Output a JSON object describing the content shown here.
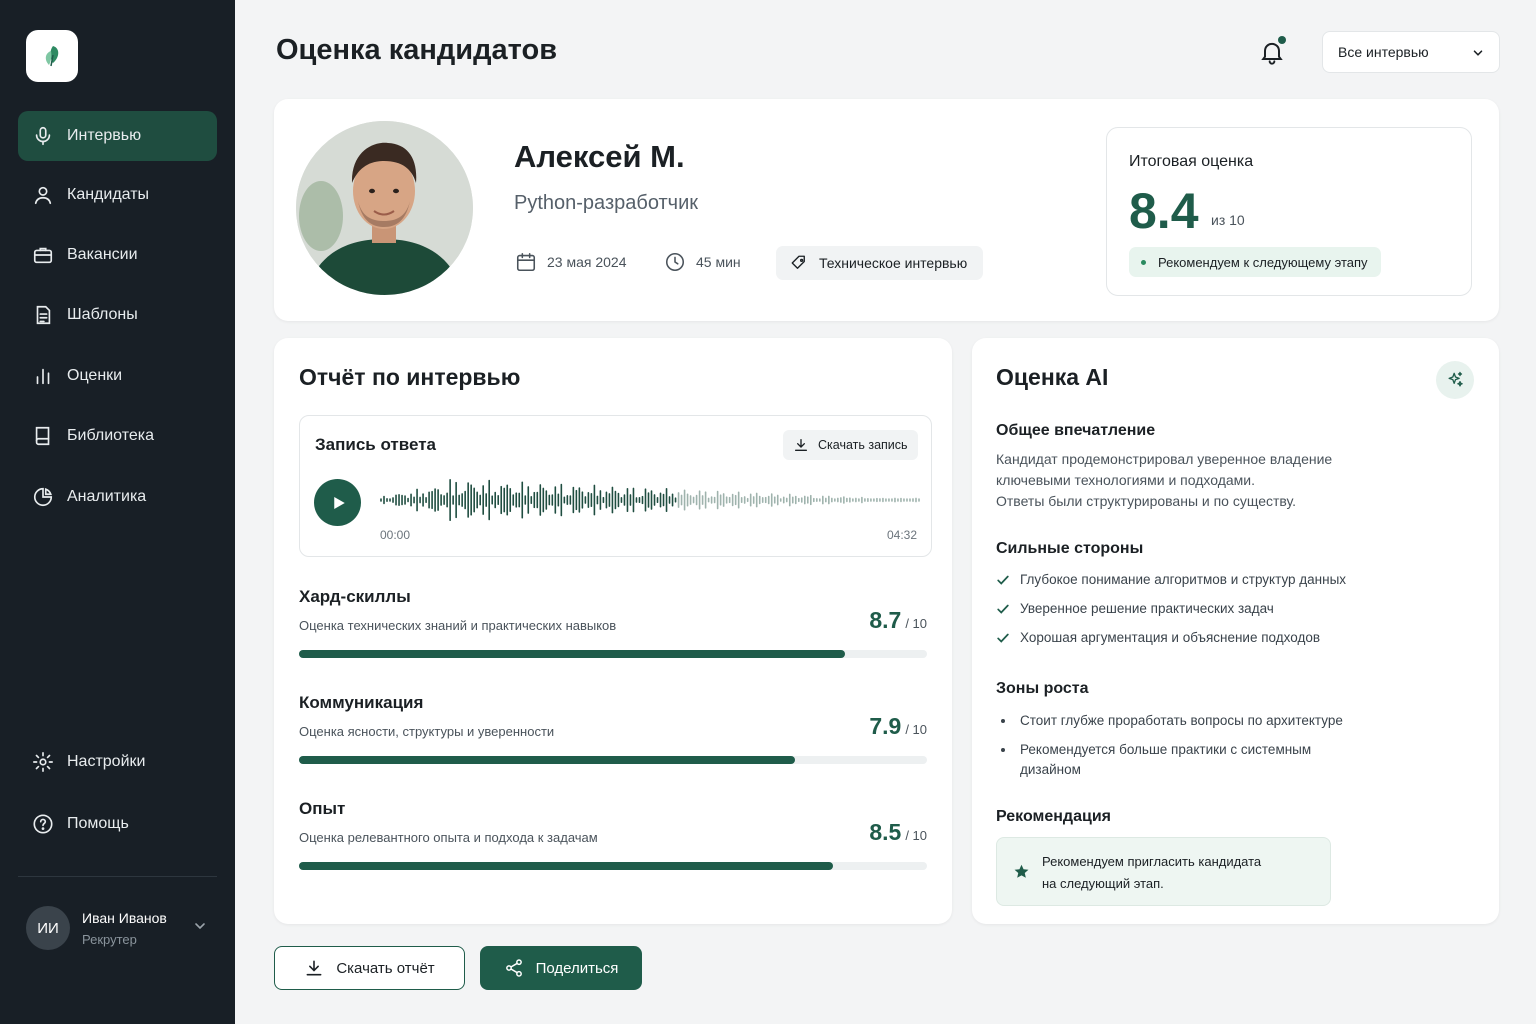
{
  "colors": {
    "accent": "#1f5c4a",
    "sidebar_bg": "#181f26",
    "active_nav": "#1f4d40",
    "badge_bg": "#e8f4ee"
  },
  "sidebar": {
    "logo_icon": "leaf-icon",
    "items": [
      {
        "label": "Интервью",
        "icon": "microphone-icon",
        "active": true
      },
      {
        "label": "Кандидаты",
        "icon": "user-icon"
      },
      {
        "label": "Вакансии",
        "icon": "briefcase-icon"
      },
      {
        "label": "Шаблоны",
        "icon": "document-icon"
      },
      {
        "label": "Оценки",
        "icon": "bar-chart-icon"
      },
      {
        "label": "Библиотека",
        "icon": "book-icon"
      },
      {
        "label": "Аналитика",
        "icon": "pie-chart-icon"
      }
    ],
    "bottom_items": [
      {
        "label": "Настройки",
        "icon": "gear-icon"
      },
      {
        "label": "Помощь",
        "icon": "help-icon"
      }
    ],
    "user": {
      "initials": "ИИ",
      "name": "Иван Иванов",
      "role": "Рекрутер"
    }
  },
  "header": {
    "title": "Оценка кандидатов",
    "filter": "Все интервью"
  },
  "candidate": {
    "name": "Алексей М.",
    "role": "Python-разработчик",
    "date": "23 мая 2024",
    "duration": "45 мин",
    "interview_type": "Техническое интервью",
    "score_label": "Итоговая оценка",
    "score": "8.4",
    "score_of": "из 10",
    "recommendation": "Рекомендуем к следующему этапу"
  },
  "report": {
    "title": "Отчёт по интервью",
    "audio": {
      "title": "Запись ответа",
      "download_label": "Скачать запись",
      "start_time": "00:00",
      "end_time": "04:32",
      "progress": 0.0
    },
    "skills": [
      {
        "name": "Хард-скиллы",
        "desc": "Оценка технических знаний и практических навыков",
        "score": "8.7",
        "of": "/ 10",
        "value": 8.7
      },
      {
        "name": "Коммуникация",
        "desc": "Оценка ясности, структуры и уверенности",
        "score": "7.9",
        "of": "/ 10",
        "value": 7.9
      },
      {
        "name": "Опыт",
        "desc": "Оценка релевантного опыта и подхода к задачам",
        "score": "8.5",
        "of": "/ 10",
        "value": 8.5
      }
    ]
  },
  "ai": {
    "title": "Оценка AI",
    "impression_title": "Общее впечатление",
    "impression_lines": [
      "Кандидат продемонстрировал уверенное владение",
      "ключевыми технологиями и подходами.",
      "Ответы были структурированы и по существу."
    ],
    "strengths_title": "Сильные стороны",
    "strengths": [
      "Глубокое понимание алгоритмов и структур данных",
      "Уверенное решение практических задач",
      "Хорошая аргументация и объяснение подходов"
    ],
    "growth_title": "Зоны роста",
    "growth": [
      "Стоит глубже проработать вопросы по архитектуре",
      "Рекомендуется больше практики с системным дизайном"
    ],
    "recommendation_title": "Рекомендация",
    "recommendation_lines": [
      "Рекомендуем пригласить кандидата",
      "на следующий этап."
    ]
  },
  "actions": {
    "download_report": "Скачать отчёт",
    "share": "Поделиться"
  }
}
